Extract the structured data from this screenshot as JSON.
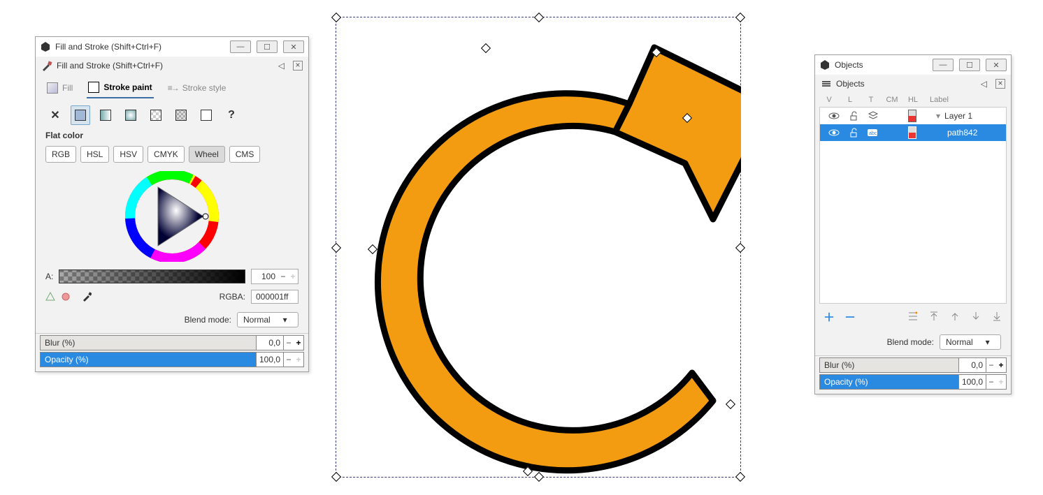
{
  "fill_stroke": {
    "window_title": "Fill and Stroke (Shift+Ctrl+F)",
    "sub_title": "Fill and Stroke (Shift+Ctrl+F)",
    "tab_fill": "Fill",
    "tab_stroke_paint": "Stroke paint",
    "tab_stroke_style": "Stroke style",
    "flat_color_label": "Flat color",
    "mode_rgb": "RGB",
    "mode_hsl": "HSL",
    "mode_hsv": "HSV",
    "mode_cmyk": "CMYK",
    "mode_wheel": "Wheel",
    "mode_cms": "CMS",
    "alpha_label": "A:",
    "alpha_value": "100",
    "rgba_label": "RGBA:",
    "rgba_value": "000001ff",
    "blend_label": "Blend mode:",
    "blend_value": "Normal",
    "blur_label": "Blur (%)",
    "blur_value": "0,0",
    "opacity_label": "Opacity (%)",
    "opacity_value": "100,0"
  },
  "objects": {
    "window_title": "Objects",
    "sub_title": "Objects",
    "col_v": "V",
    "col_l": "L",
    "col_t": "T",
    "col_cm": "CM",
    "col_hl": "HL",
    "col_label": "Label",
    "layer_label": "Layer 1",
    "path_label": "path842",
    "blend_label": "Blend mode:",
    "blend_value": "Normal",
    "blur_label": "Blur (%)",
    "blur_value": "0,0",
    "opacity_label": "Opacity (%)",
    "opacity_value": "100,0"
  },
  "canvas": {
    "arrow_fill": "#f39c12",
    "arrow_stroke": "#000000"
  }
}
